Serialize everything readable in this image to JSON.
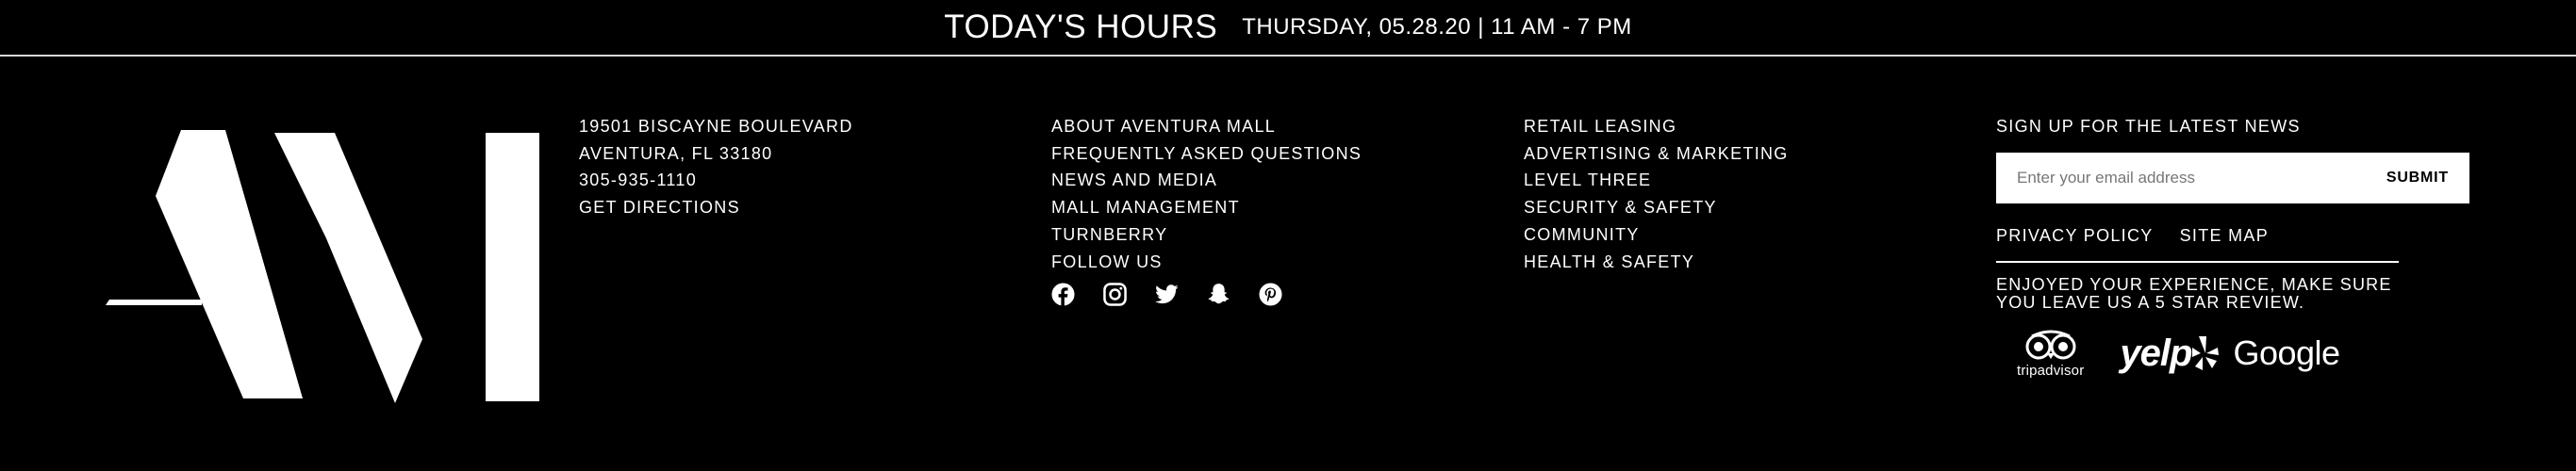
{
  "hours": {
    "title": "TODAY'S HOURS",
    "detail": "THURSDAY, 05.28.20 | 11 AM - 7 PM"
  },
  "logo": {
    "name": "logo-icon"
  },
  "address": [
    {
      "label": "19501 BISCAYNE BOULEVARD"
    },
    {
      "label": "AVENTURA, FL 33180"
    },
    {
      "label": "305-935-1110"
    },
    {
      "label": "GET DIRECTIONS"
    }
  ],
  "links_primary": [
    {
      "label": "ABOUT AVENTURA MALL"
    },
    {
      "label": "FREQUENTLY ASKED QUESTIONS"
    },
    {
      "label": "NEWS AND MEDIA"
    },
    {
      "label": "MALL MANAGEMENT"
    },
    {
      "label": "TURNBERRY"
    },
    {
      "label": "FOLLOW US"
    }
  ],
  "social_icons": [
    "facebook-icon",
    "instagram-icon",
    "twitter-icon",
    "snapchat-icon",
    "pinterest-icon"
  ],
  "links_secondary": [
    {
      "label": "RETAIL LEASING"
    },
    {
      "label": "ADVERTISING & MARKETING"
    },
    {
      "label": "LEVEL THREE"
    },
    {
      "label": "SECURITY & SAFETY"
    },
    {
      "label": "COMMUNITY"
    },
    {
      "label": "HEALTH & SAFETY"
    }
  ],
  "signup": {
    "title": "SIGN UP FOR THE LATEST NEWS",
    "placeholder": "Enter your email address",
    "value": "",
    "submit_label": "SUBMIT"
  },
  "policy_links": {
    "privacy": "PRIVACY POLICY",
    "sitemap": "SITE MAP"
  },
  "review": {
    "text": "ENJOYED YOUR EXPERIENCE, MAKE SURE YOU LEAVE US A 5 STAR REVIEW.",
    "tripadvisor": "tripadvisor",
    "yelp": "yelp",
    "google": "Google"
  },
  "colors": {
    "background": "#000000",
    "text": "#ffffff",
    "input_background": "#ffffff"
  }
}
